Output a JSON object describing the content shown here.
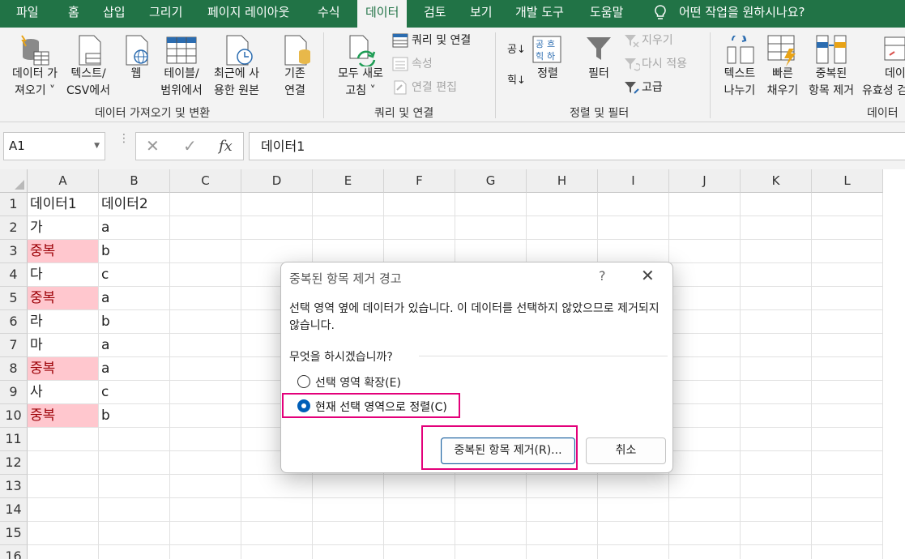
{
  "colors": {
    "accent": "#217346",
    "duplicate_fill": "#ffc7ce",
    "duplicate_text": "#9c0006",
    "highlight": "#e3007a"
  },
  "menu": {
    "tabs": [
      "파일",
      "홈",
      "삽입",
      "그리기",
      "페이지 레이아웃",
      "수식",
      "데이터",
      "검토",
      "보기",
      "개발 도구",
      "도움말"
    ],
    "active_tab": "데이터",
    "tell_me": "어떤 작업을 원하시나요?"
  },
  "ribbon": {
    "get_data": {
      "line1": "데이터 가",
      "line2": "져오기 ˅"
    },
    "from_csv": {
      "line1": "텍스트/",
      "line2": "CSV에서"
    },
    "web": {
      "line1": "웹"
    },
    "from_table": {
      "line1": "테이블/",
      "line2": "범위에서"
    },
    "recent_sources": {
      "line1": "최근에 사",
      "line2": "용한 원본"
    },
    "existing_conn": {
      "line1": "기존",
      "line2": "연결"
    },
    "group_get": "데이터 가져오기 및 변환",
    "refresh_all": {
      "line1": "모두 새로",
      "line2": "고침 ˅"
    },
    "queries_conn": "쿼리 및 연결",
    "properties": "속성",
    "edit_links": "연결 편집",
    "group_queries": "쿼리 및 연결",
    "sort_az": "공↓",
    "sort_za": "힉↓",
    "sort": "정렬",
    "filter": "필터",
    "clear": "지우기",
    "reapply": "다시 적용",
    "advanced": "고급",
    "group_sort": "정렬 및 필터",
    "text_to_columns": {
      "line1": "텍스트",
      "line2": "나누기"
    },
    "flash_fill": {
      "line1": "빠른",
      "line2": "채우기"
    },
    "remove_duplicates": {
      "line1": "중복된",
      "line2": "항목 제거"
    },
    "validation": {
      "line1": "데이",
      "line2": "유효성 검"
    },
    "group_tools": "데이터"
  },
  "formula_bar": {
    "name_box": "A1",
    "cancel": "✕",
    "enter": "✓",
    "fx": "fx",
    "value": "데이터1"
  },
  "sheet": {
    "columns": [
      "A",
      "B",
      "C",
      "D",
      "E",
      "F",
      "G",
      "H",
      "I",
      "J",
      "K",
      "L"
    ],
    "rows": [
      "1",
      "2",
      "3",
      "4",
      "5",
      "6",
      "7",
      "8",
      "9",
      "10",
      "11",
      "12",
      "13",
      "14",
      "15",
      "16"
    ],
    "col_a": [
      "데이터1",
      "가",
      "중복",
      "다",
      "중복",
      "라",
      "마",
      "중복",
      "사",
      "중복"
    ],
    "col_b": [
      "데이터2",
      "a",
      "b",
      "c",
      "a",
      "b",
      "a",
      "a",
      "c",
      "b"
    ],
    "duplicate_flags": [
      false,
      false,
      true,
      false,
      true,
      false,
      false,
      true,
      false,
      true
    ]
  },
  "dialog": {
    "title": "중복된 항목 제거 경고",
    "help": "?",
    "close": "✕",
    "message": "선택 영역 옆에 데이터가 있습니다. 이 데이터를 선택하지 않았으므로 제거되지 않습니다.",
    "question": "무엇을 하시겠습니까?",
    "option_expand": "선택 영역 확장(E)",
    "option_current": "현재 선택 영역으로 정렬(C)",
    "selected_option": "option_current",
    "remove_button": "중복된 항목 제거(R)...",
    "cancel_button": "취소"
  }
}
